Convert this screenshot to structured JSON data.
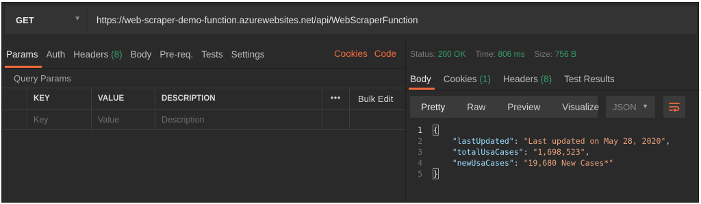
{
  "request": {
    "method": "GET",
    "url": "https://web-scraper-demo-function.azurewebsites.net/api/WebScraperFunction"
  },
  "request_tabs": [
    {
      "label": "Params",
      "count": ""
    },
    {
      "label": "Auth",
      "count": ""
    },
    {
      "label": "Headers",
      "count": "(8)"
    },
    {
      "label": "Body",
      "count": ""
    },
    {
      "label": "Pre-req.",
      "count": ""
    },
    {
      "label": "Tests",
      "count": ""
    },
    {
      "label": "Settings",
      "count": ""
    }
  ],
  "request_links": {
    "cookies": "Cookies",
    "code": "Code"
  },
  "query_params": {
    "title": "Query Params",
    "headers": {
      "key": "KEY",
      "value": "VALUE",
      "description": "DESCRIPTION"
    },
    "bulk_edit": "Bulk Edit",
    "more": "•••",
    "placeholders": {
      "key": "Key",
      "value": "Value",
      "description": "Description"
    }
  },
  "response_status": {
    "status_label": "Status:",
    "status_value": "200 OK",
    "time_label": "Time:",
    "time_value": "806 ms",
    "size_label": "Size:",
    "size_value": "756 B"
  },
  "response_tabs": [
    {
      "label": "Body",
      "count": ""
    },
    {
      "label": "Cookies",
      "count": "(1)"
    },
    {
      "label": "Headers",
      "count": "(8)"
    },
    {
      "label": "Test Results",
      "count": ""
    }
  ],
  "view_modes": [
    "Pretty",
    "Raw",
    "Preview",
    "Visualize"
  ],
  "format": "JSON",
  "code_lines": [
    {
      "n": "1",
      "key": "",
      "value": ""
    },
    {
      "n": "2",
      "key": "\"lastUpdated\"",
      "value": "\"Last updated on May 28, 2020\""
    },
    {
      "n": "3",
      "key": "\"totalUsaCases\"",
      "value": "\"1,698,523\""
    },
    {
      "n": "4",
      "key": "\"newUsaCases\"",
      "value": "\"19,680 New Cases*\""
    },
    {
      "n": "5",
      "key": "",
      "value": ""
    }
  ],
  "colors": {
    "accent": "#f26b3a",
    "success": "#33a06b",
    "background": "#2a2a2a"
  },
  "icons": {
    "method_dropdown": "chevron-down-icon",
    "format_dropdown": "chevron-down-icon",
    "wrap": "wrap-lines-icon"
  }
}
